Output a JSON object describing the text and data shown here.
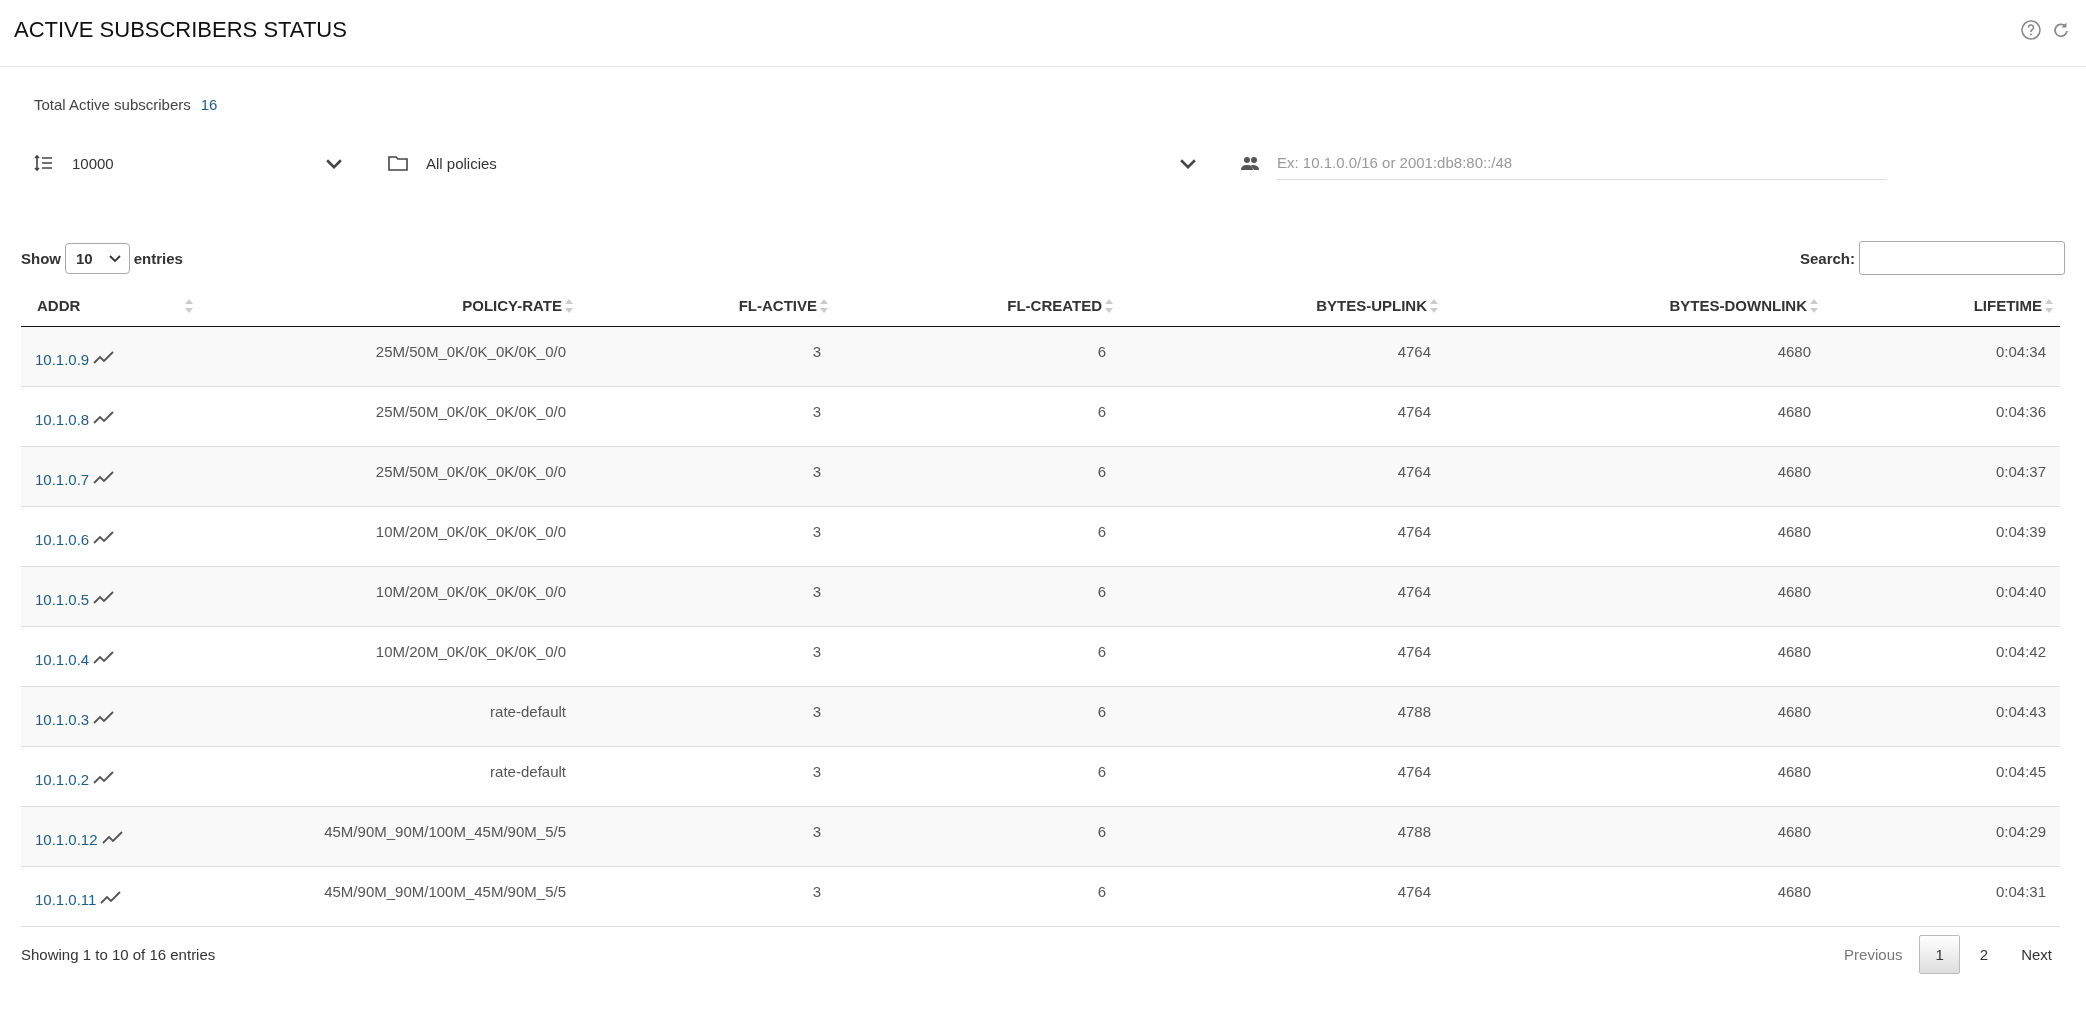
{
  "header": {
    "title": "ACTIVE SUBSCRIBERS STATUS"
  },
  "summary": {
    "label": "Total Active subscribers",
    "value": "16"
  },
  "filters": {
    "limit": "10000",
    "policy": "All policies",
    "address_placeholder": "Ex: 10.1.0.0/16 or 2001:db8:80::/48"
  },
  "length_menu": {
    "before": "Show",
    "value": "10",
    "after": "entries"
  },
  "search": {
    "label": "Search:"
  },
  "table": {
    "columns": [
      "ADDR",
      "POLICY-RATE",
      "FL-ACTIVE",
      "FL-CREATED",
      "BYTES-UPLINK",
      "BYTES-DOWNLINK",
      "LIFETIME"
    ],
    "rows": [
      {
        "cells": [
          "10.1.0.9",
          "25M/50M_0K/0K_0K/0K_0/0",
          "3",
          "6",
          "4764",
          "4680",
          "0:04:34"
        ]
      },
      {
        "cells": [
          "10.1.0.8",
          "25M/50M_0K/0K_0K/0K_0/0",
          "3",
          "6",
          "4764",
          "4680",
          "0:04:36"
        ]
      },
      {
        "cells": [
          "10.1.0.7",
          "25M/50M_0K/0K_0K/0K_0/0",
          "3",
          "6",
          "4764",
          "4680",
          "0:04:37"
        ]
      },
      {
        "cells": [
          "10.1.0.6",
          "10M/20M_0K/0K_0K/0K_0/0",
          "3",
          "6",
          "4764",
          "4680",
          "0:04:39"
        ]
      },
      {
        "cells": [
          "10.1.0.5",
          "10M/20M_0K/0K_0K/0K_0/0",
          "3",
          "6",
          "4764",
          "4680",
          "0:04:40"
        ]
      },
      {
        "cells": [
          "10.1.0.4",
          "10M/20M_0K/0K_0K/0K_0/0",
          "3",
          "6",
          "4764",
          "4680",
          "0:04:42"
        ]
      },
      {
        "cells": [
          "10.1.0.3",
          "rate-default",
          "3",
          "6",
          "4788",
          "4680",
          "0:04:43"
        ]
      },
      {
        "cells": [
          "10.1.0.2",
          "rate-default",
          "3",
          "6",
          "4764",
          "4680",
          "0:04:45"
        ]
      },
      {
        "cells": [
          "10.1.0.12",
          "45M/90M_90M/100M_45M/90M_5/5",
          "3",
          "6",
          "4788",
          "4680",
          "0:04:29"
        ]
      },
      {
        "cells": [
          "10.1.0.11",
          "45M/90M_90M/100M_45M/90M_5/5",
          "3",
          "6",
          "4764",
          "4680",
          "0:04:31"
        ]
      }
    ]
  },
  "footer": {
    "info": "Showing 1 to 10 of 16 entries",
    "pagination": [
      {
        "label": "Previous",
        "kind": "nav",
        "disabled": true,
        "selected": false
      },
      {
        "label": "1",
        "kind": "page",
        "disabled": false,
        "selected": true
      },
      {
        "label": "2",
        "kind": "page",
        "disabled": false,
        "selected": false
      },
      {
        "label": "Next",
        "kind": "nav",
        "disabled": false,
        "selected": false
      }
    ]
  }
}
